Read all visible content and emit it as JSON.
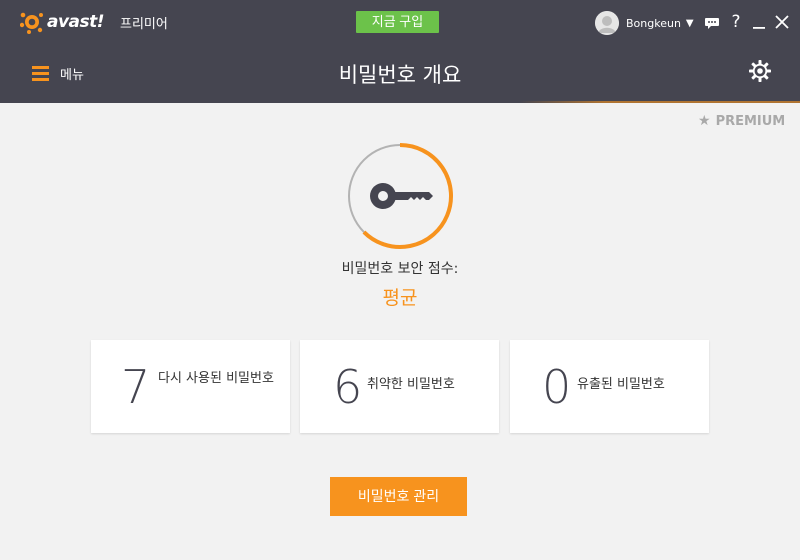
{
  "app": {
    "logo_text": "avast!",
    "edition": "프리미어",
    "buy_button": "지금 구입",
    "user_name": "Bongkeun",
    "colors": {
      "bar": "#454550",
      "accent": "#f7931e",
      "buy": "#6cc24a"
    }
  },
  "header": {
    "menu_label": "메뉴",
    "title": "비밀번호 개요"
  },
  "main": {
    "premium_badge": "PREMIUM",
    "score_label": "비밀번호 보안 점수:",
    "score_value": "평균",
    "cards": [
      {
        "count": "7",
        "label": "다시 사용된 비밀번호"
      },
      {
        "count": "6",
        "label": "취약한 비밀번호"
      },
      {
        "count": "0",
        "label": "유출된 비밀번호"
      }
    ],
    "manage_button": "비밀번호 관리"
  }
}
